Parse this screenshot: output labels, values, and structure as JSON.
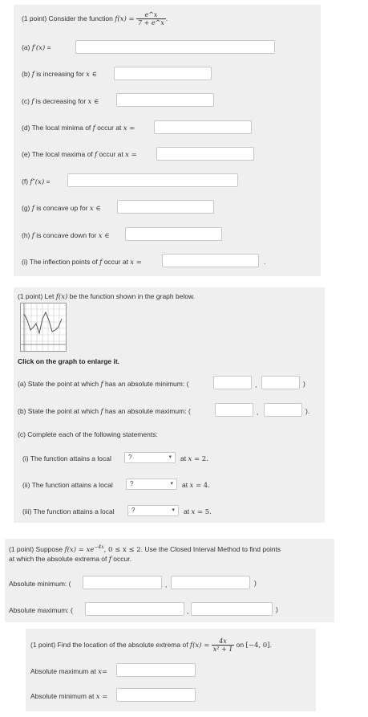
{
  "p1": {
    "prefix": "(1 point) Consider the function ",
    "fx": "f(x) =",
    "num": "e^x",
    "den": "7 + e^x",
    "end": ".",
    "a": {
      "label": "(a) ",
      "math": "f′(x)",
      "eq": " ="
    },
    "b": {
      "label": "(b) ",
      "math": "f",
      "text": " is increasing for ",
      "var": "x",
      "sym": " ∈"
    },
    "c": {
      "label": "(c) ",
      "math": "f",
      "text": " is decreasing for ",
      "var": "x",
      "sym": " ∈"
    },
    "d": {
      "label": "(d) The local minima of ",
      "math": "f",
      "text": " occur at ",
      "var": "x",
      "sym": " ="
    },
    "e": {
      "label": "(e) The local maxima of ",
      "math": "f",
      "text": " occur at ",
      "var": "x",
      "sym": " ="
    },
    "f": {
      "label": "(f) ",
      "math": "f″(x)",
      "eq": " ="
    },
    "g": {
      "label": "(g) ",
      "math": "f",
      "text": " is concave up for ",
      "var": "x",
      "sym": " ∈"
    },
    "h": {
      "label": "(h) ",
      "math": "f",
      "text": " is concave down for ",
      "var": "x",
      "sym": " ∈"
    },
    "i": {
      "label": "(i) The inflection points of ",
      "math": "f",
      "text": " occur at ",
      "var": "x",
      "sym": " =",
      "end": "."
    }
  },
  "p2": {
    "intro_a": "(1 point) Let ",
    "intro_math": "f(x)",
    "intro_b": " be the function shown in the graph below.",
    "enlarge": "Click on the graph to enlarge it.",
    "a": {
      "text_a": "(a) State the point at which ",
      "math": "f",
      "text_b": " has an absolute minimum: (",
      "comma": ",",
      "close": ")"
    },
    "b": {
      "text_a": "(b) State the point at which ",
      "math": "f",
      "text_b": " has an absolute maximum: (",
      "comma": ",",
      "close": ")."
    },
    "c": "(c) Complete each of the following statements:",
    "stmts": [
      {
        "label": "(i) The function attains a local",
        "value": "?",
        "at": "at ",
        "var": "x",
        "eq": " = 2."
      },
      {
        "label": "(ii) The function attains a local",
        "value": "?",
        "at": "at ",
        "var": "x",
        "eq": " = 4."
      },
      {
        "label": "(iii) The function attains a local",
        "value": "?",
        "at": "at ",
        "var": "x",
        "eq": " = 5."
      }
    ]
  },
  "p3": {
    "line1_a": "(1 point) Suppose ",
    "line1_math": "f(x) = xe",
    "line1_exp": "−4x",
    "line1_b": ",   0 ≤ x ≤ 2",
    "line1_c": ". Use the Closed Interval Method to find points",
    "line2_a": "at which the absolute extrema of ",
    "line2_math": "f",
    "line2_b": " occur.",
    "min_label": "Absolute minimum: (",
    "max_label": "Absolute maximum: (",
    "comma": ",",
    "close": ")"
  },
  "p4": {
    "intro": "(1 point) Find the location of the absolute extrema of ",
    "fx": "f(x) =",
    "num": "4x",
    "den": "x² + 1",
    "on": " on ",
    "interval": "[−4, 0]",
    "end": ".",
    "max_label": "Absolute maximum at ",
    "max_var": "x",
    "max_eq": "=",
    "min_label": "Absolute minimum at ",
    "min_var": "x",
    "min_eq": " ="
  },
  "colors": {
    "panel_bg": "#efefef",
    "input_border": "#c8c8c8",
    "text": "#333333"
  },
  "icons": {
    "caret": "chevron-down-icon"
  }
}
